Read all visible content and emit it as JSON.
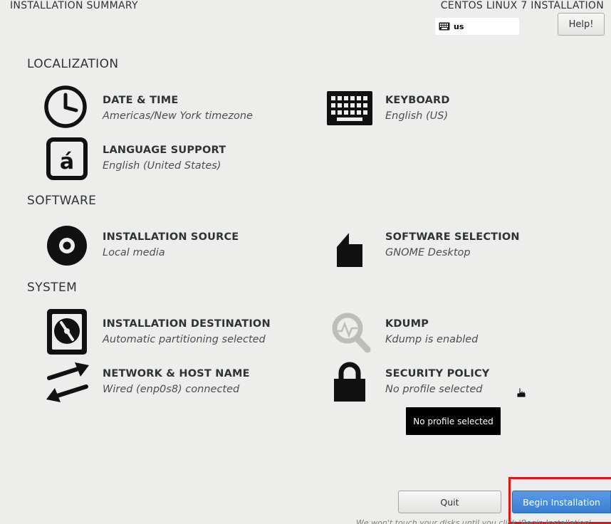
{
  "header": {
    "title": "INSTALLATION SUMMARY",
    "product": "CENTOS LINUX 7 INSTALLATION",
    "keyboard_layout": "us",
    "help_label": "Help!"
  },
  "sections": {
    "localization": "LOCALIZATION",
    "software": "SOFTWARE",
    "system": "SYSTEM"
  },
  "spokes": {
    "date_time": {
      "title": "DATE & TIME",
      "status": "Americas/New York timezone",
      "icon": "clock-icon"
    },
    "keyboard": {
      "title": "KEYBOARD",
      "status": "English (US)",
      "icon": "keyboard-icon"
    },
    "language": {
      "title": "LANGUAGE SUPPORT",
      "status": "English (United States)",
      "icon": "language-icon"
    },
    "source": {
      "title": "INSTALLATION SOURCE",
      "status": "Local media",
      "icon": "disc-icon"
    },
    "software_selection": {
      "title": "SOFTWARE SELECTION",
      "status": "GNOME Desktop",
      "icon": "package-icon"
    },
    "destination": {
      "title": "INSTALLATION DESTINATION",
      "status": "Automatic partitioning selected",
      "icon": "hard-drive-icon"
    },
    "kdump": {
      "title": "KDUMP",
      "status": "Kdump is enabled",
      "icon": "magnifier-icon"
    },
    "network": {
      "title": "NETWORK & HOST NAME",
      "status": "Wired (enp0s8) connected",
      "icon": "network-arrows-icon"
    },
    "security": {
      "title": "SECURITY POLICY",
      "status": "No profile selected",
      "icon": "lock-icon"
    }
  },
  "tooltip": {
    "text": "No profile selected"
  },
  "footer": {
    "quit_label": "Quit",
    "begin_label": "Begin Installation",
    "note": "We won't touch your disks until you click 'Begin Installation'."
  },
  "colors": {
    "background": "#ededec",
    "primary_button": "#3a7ed2",
    "highlight": "#e0161e"
  }
}
